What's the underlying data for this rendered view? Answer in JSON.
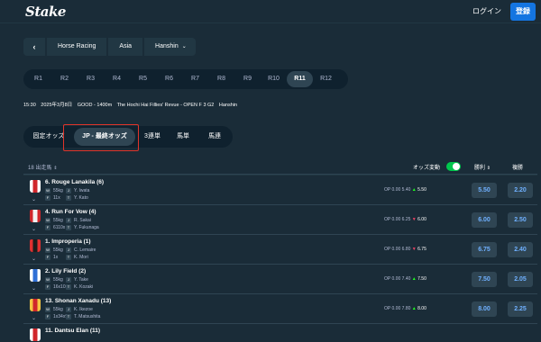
{
  "header": {
    "logo": "Stake",
    "login": "ログイン",
    "register": "登録"
  },
  "breadcrumb": {
    "back_icon": "chevron-left-icon",
    "items": [
      "Horse Racing",
      "Asia",
      "Hanshin"
    ]
  },
  "races": {
    "items": [
      "R1",
      "R2",
      "R3",
      "R4",
      "R5",
      "R6",
      "R7",
      "R8",
      "R9",
      "R10",
      "R11",
      "R12"
    ],
    "active": "R11"
  },
  "race_info": {
    "time": "15:30",
    "date": "2025年3月8日",
    "going": "GOOD - 1400m",
    "title": "The Hochi Hai Fillies' Revue - OPEN F 3 G2",
    "venue": "Hanshin"
  },
  "odds_tabs": {
    "items": [
      "固定オッズ",
      "JP - 最終オッズ",
      "3連単",
      "馬単",
      "馬連"
    ],
    "active": "JP - 最終オッズ"
  },
  "table": {
    "runners_header": "18 出走馬",
    "odds_change_label": "オッズ変動",
    "odds_change_on": true,
    "win_header": "勝利",
    "place_header": "複勝",
    "rows": [
      {
        "name": "6. Rouge Lanakila (6)",
        "weight": "55kg",
        "jockey": "Y. Iwata",
        "form": "11x",
        "trainer": "Y. Kato",
        "op": "OP 0.00",
        "prev": "5.40",
        "dir": "up",
        "cur": "5.50",
        "win": "5.50",
        "place": "2.20",
        "silk_color": "#d0262b",
        "silk_accent": "#ffffff"
      },
      {
        "name": "4. Run For Vow (4)",
        "weight": "55kg",
        "jockey": "R. Sakai",
        "form": "6110x",
        "trainer": "Y. Fukunaga",
        "op": "OP 0.00",
        "prev": "6.25",
        "dir": "down",
        "cur": "6.00",
        "win": "6.00",
        "place": "2.50",
        "silk_color": "#f2f2f2",
        "silk_accent": "#d0262b"
      },
      {
        "name": "1. Improperia (1)",
        "weight": "55kg",
        "jockey": "C. Lemaire",
        "form": "1x",
        "trainer": "K. Mori",
        "op": "OP 0.00",
        "prev": "6.80",
        "dir": "down",
        "cur": "6.75",
        "win": "6.75",
        "place": "2.40",
        "silk_color": "#1c1c1c",
        "silk_accent": "#e03030"
      },
      {
        "name": "2. Lily Field (2)",
        "weight": "55kg",
        "jockey": "Y. Take",
        "form": "16x10x",
        "trainer": "K. Kozaki",
        "op": "OP 0.00",
        "prev": "7.40",
        "dir": "up",
        "cur": "7.50",
        "win": "7.50",
        "place": "2.05",
        "silk_color": "#2f6fd6",
        "silk_accent": "#ffffff"
      },
      {
        "name": "13. Shonan Xanadu (13)",
        "weight": "55kg",
        "jockey": "K. Ikezoe",
        "form": "1x34x9",
        "trainer": "T. Matsushita",
        "op": "OP 0.00",
        "prev": "7.80",
        "dir": "up",
        "cur": "8.00",
        "win": "8.00",
        "place": "2.25",
        "silk_color": "#d0262b",
        "silk_accent": "#f5c542"
      },
      {
        "name": "11. Dantsu Elan (11)",
        "weight": "",
        "jockey": "",
        "form": "",
        "trainer": "",
        "op": "",
        "prev": "",
        "dir": "",
        "cur": "",
        "win": "",
        "place": "",
        "silk_color": "#d0262b",
        "silk_accent": "#ffffff"
      }
    ]
  },
  "meta_tags": {
    "weight": "W",
    "jockey": "J",
    "form": "F",
    "trainer": "T"
  }
}
